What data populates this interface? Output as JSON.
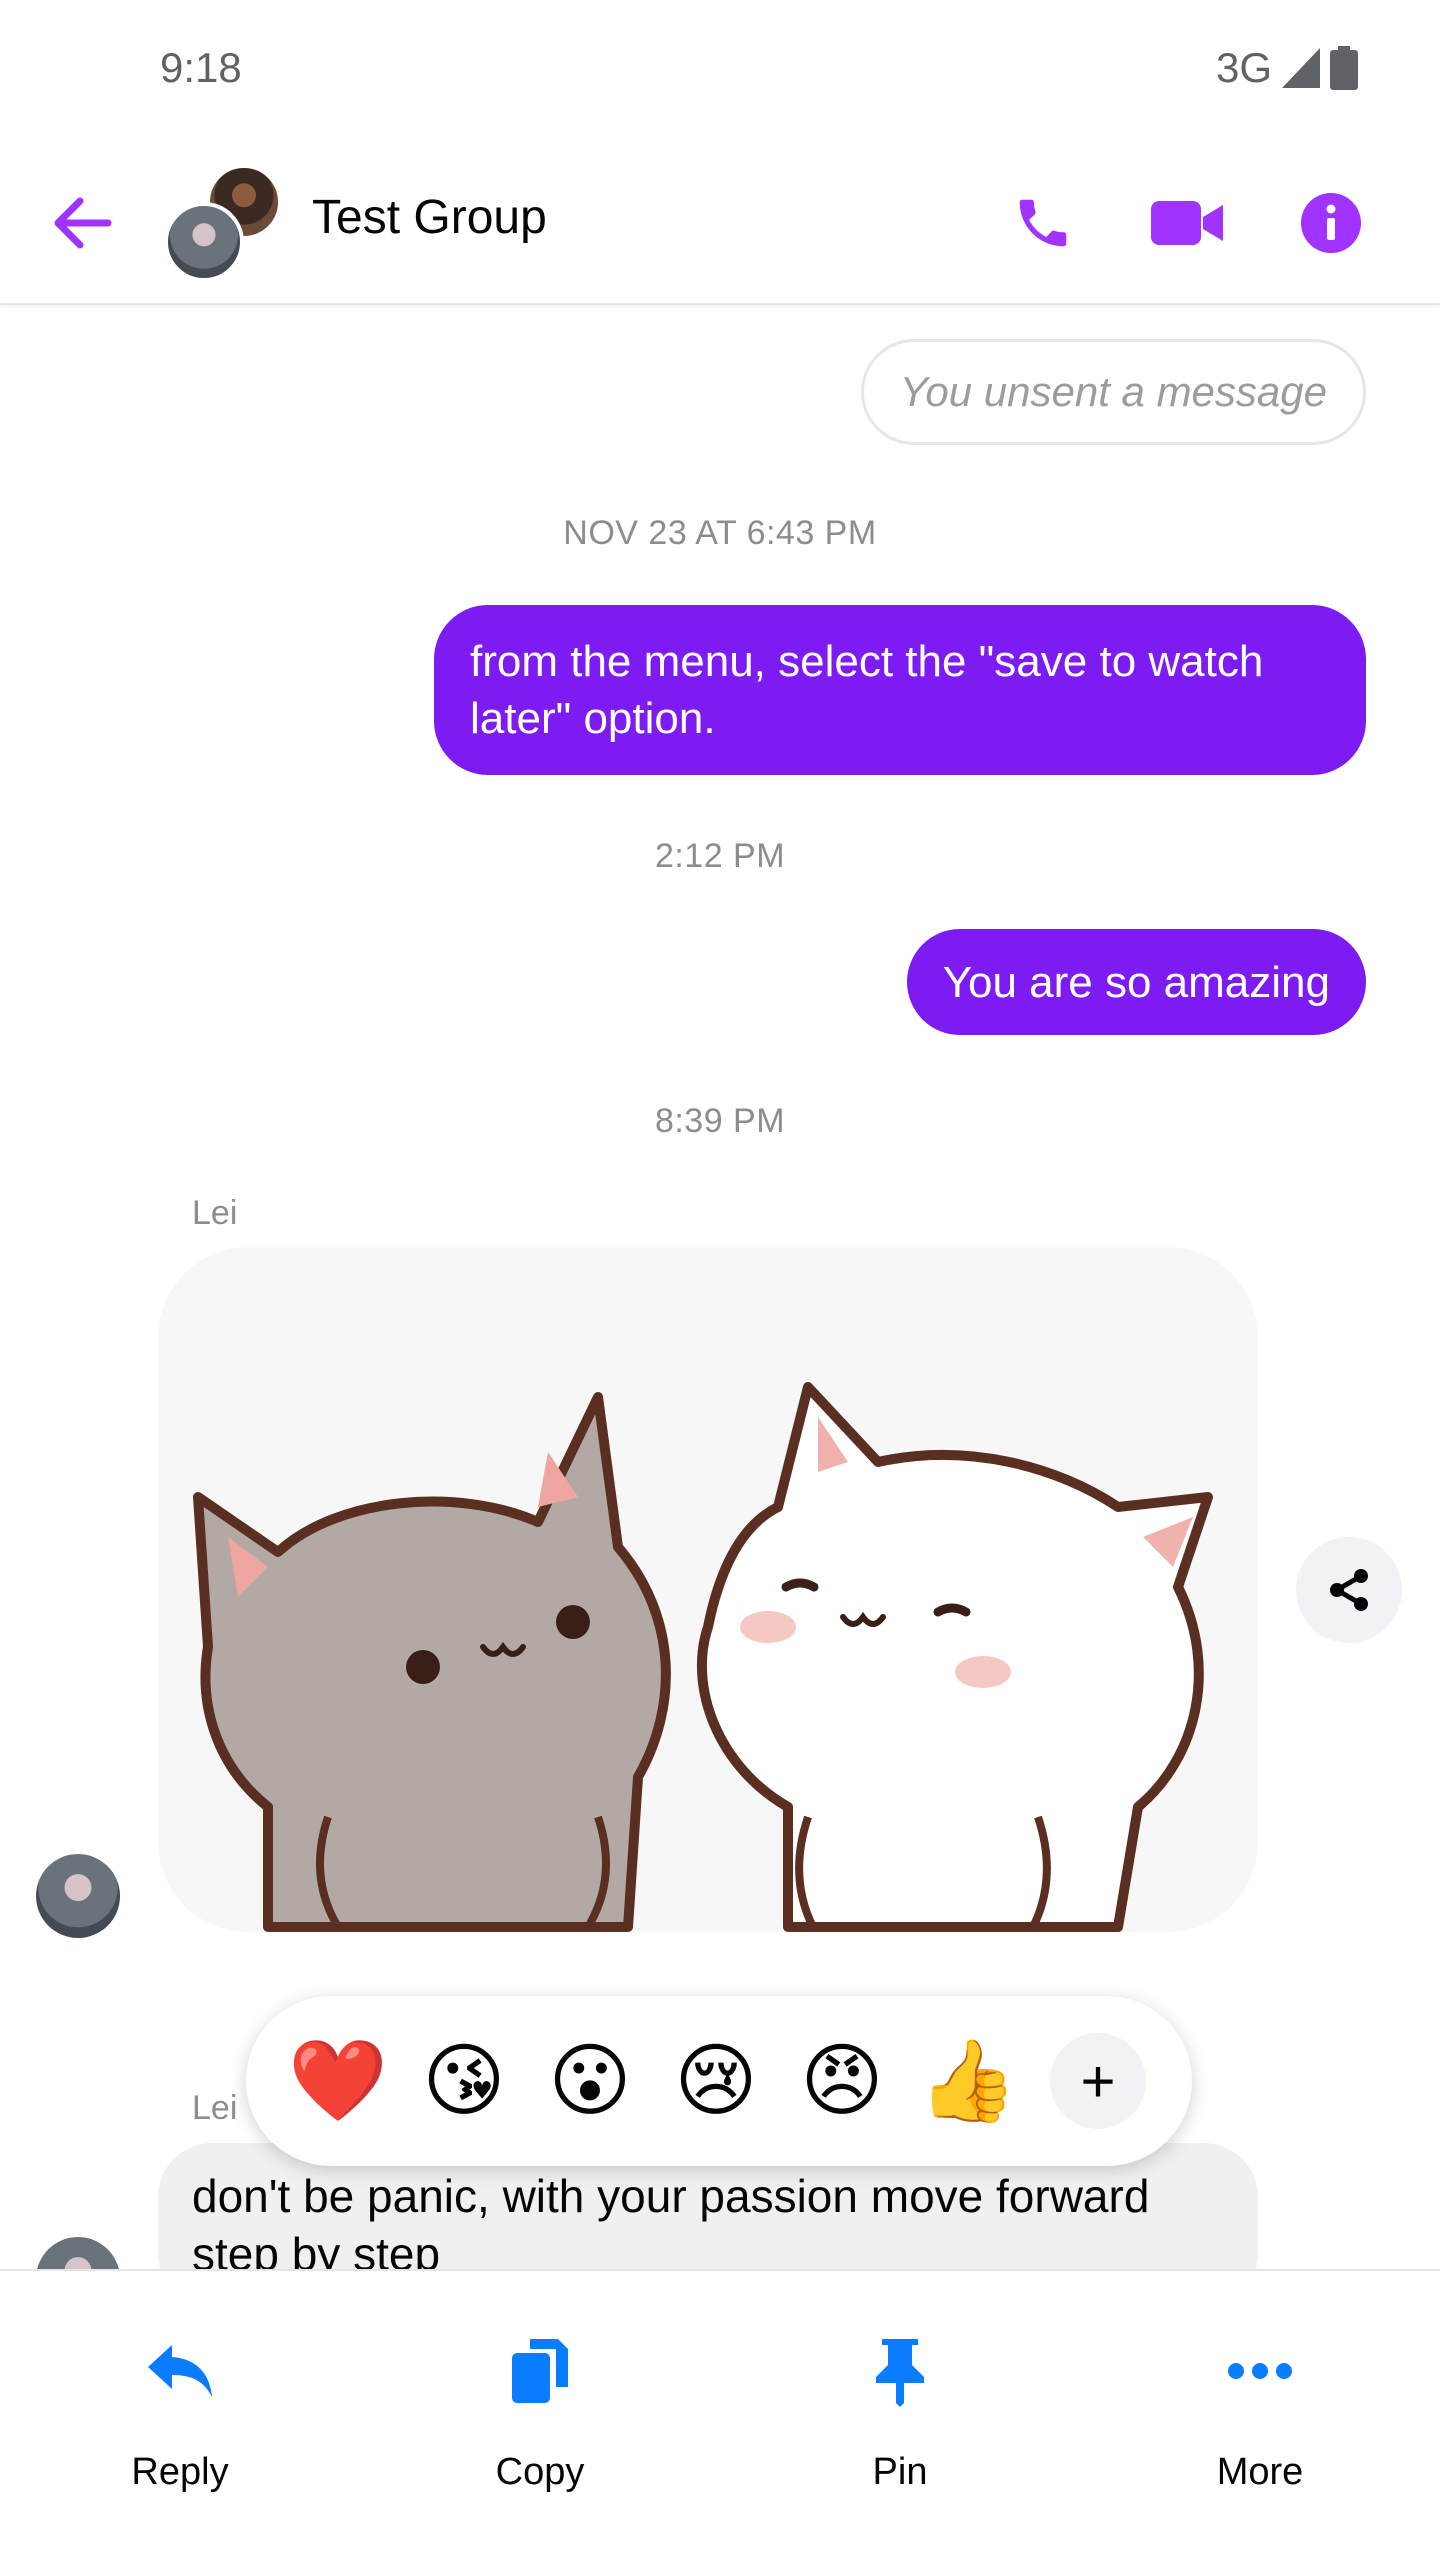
{
  "status_bar": {
    "time": "9:18",
    "network": "3G"
  },
  "header": {
    "title": "Test Group"
  },
  "messages": {
    "unsent": "You unsent a message",
    "timestamp_1": "NOV 23 AT 6:43 PM",
    "outgoing_1": "from the menu, select the \"save to watch later\" option.",
    "timestamp_2": "2:12 PM",
    "outgoing_2": "You are so amazing",
    "timestamp_3": "8:39 PM",
    "sender_1": "Lei",
    "sender_2": "Lei",
    "incoming_text": "don't be panic, with your passion move forward step by step"
  },
  "reactions": [
    "❤️",
    "😘",
    "😮",
    "😢",
    "😠",
    "👍"
  ],
  "reaction_more": "+",
  "actions": {
    "reply": "Reply",
    "copy": "Copy",
    "pin": "Pin",
    "more": "More"
  },
  "colors": {
    "accent": "#a033ff",
    "outgoing_bubble": "#7c1cf3",
    "action_blue": "#0a7cff"
  }
}
